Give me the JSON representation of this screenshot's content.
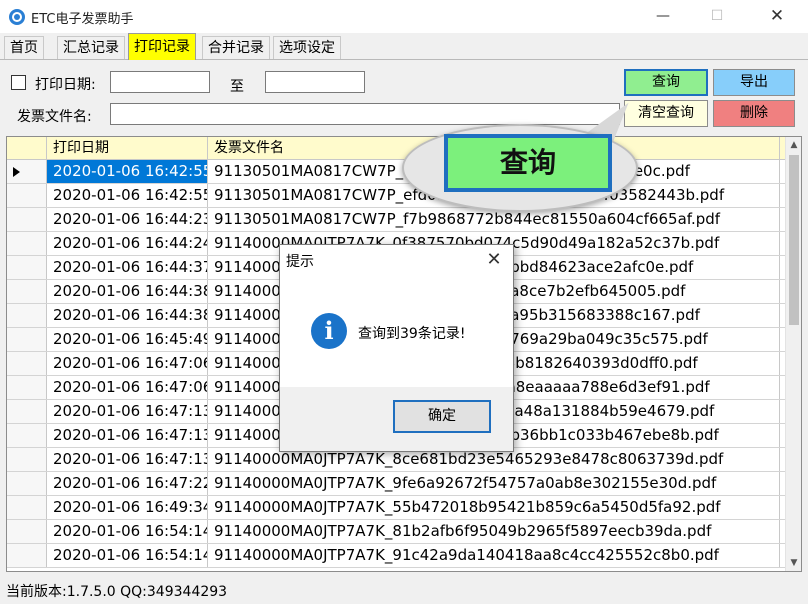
{
  "window": {
    "title": "ETC电子发票助手",
    "minimize": "—",
    "maximize": "☐",
    "close": "✕"
  },
  "tabs": [
    {
      "label": "首页"
    },
    {
      "label": "汇总记录"
    },
    {
      "label": "打印记录",
      "active": true
    },
    {
      "label": "合并记录"
    },
    {
      "label": "选项设定"
    }
  ],
  "filters": {
    "print_date_label": "打印日期:",
    "to_label": "至",
    "start_date": "",
    "end_date": "",
    "filename_label": "发票文件名:",
    "filename_value": ""
  },
  "buttons": {
    "query": "查询",
    "export": "导出",
    "clear_query": "清空查询",
    "delete": "删除"
  },
  "colors": {
    "query": "#90ee90",
    "export": "#87cefa",
    "clear_query": "#ffffe0",
    "delete": "#f08080",
    "header": "#fffbcc",
    "selection": "#0078d7"
  },
  "grid": {
    "columns": [
      "打印日期",
      "发票文件名"
    ],
    "rows": [
      {
        "date": "2020-01-06 16:42:55",
        "file": "91130501MA0817CW7P_e0ce2e22ee4b0f8e3d1d8b47ae0c.pdf"
      },
      {
        "date": "2020-01-06 16:42:55",
        "file": "91130501MA0817CW7P_efd01e4906074fbf9587b7403582443b.pdf"
      },
      {
        "date": "2020-01-06 16:44:23",
        "file": "91130501MA0817CW7P_f7b9868772b844ec81550a604cf665af.pdf"
      },
      {
        "date": "2020-01-06 16:44:24",
        "file": "91140000MA0JTP7A7K_0f387570bd074c5d90d49a182a52c37b.pdf"
      },
      {
        "date": "2020-01-06 16:44:37",
        "file": "91140000MA0JTP7A7K_1b3e2c0e5f6d4bbd84623ace2afc0e.pdf"
      },
      {
        "date": "2020-01-06 16:44:38",
        "file": "91140000MA0JTP7A7K_2c4e1f0a9b5d1a8ce7b2efb645005.pdf"
      },
      {
        "date": "2020-01-06 16:44:38",
        "file": "91140000MA0JTP7A7K_3d6b8a7e2c1f4a95b315683388c167.pdf"
      },
      {
        "date": "2020-01-06 16:45:49",
        "file": "91140000MA0JTP7A7K_4e7c9b8f3d2e4769a29ba049c35c575.pdf"
      },
      {
        "date": "2020-01-06 16:47:06",
        "file": "91140000MA0JTP7A7K_5f8dac9e4e3f48b8182640393d0dff0.pdf"
      },
      {
        "date": "2020-01-06 16:47:06",
        "file": "91140000MA0JTP7A7K_6a9ebdaf5f4e4a8eaaaaa788e6d3ef91.pdf"
      },
      {
        "date": "2020-01-06 16:47:13",
        "file": "91140000MA0JTP7A7K_7bafce0a6a5f4aa48a131884b59e4679.pdf"
      },
      {
        "date": "2020-01-06 16:47:13",
        "file": "91140000MA0JTP7A7K_8cb0df1b7b6a4b36bb1c033b467ebe8b.pdf"
      },
      {
        "date": "2020-01-06 16:47:13",
        "file": "91140000MA0JTP7A7K_8ce681bd23e5465293e8478c8063739d.pdf"
      },
      {
        "date": "2020-01-06 16:47:22",
        "file": "91140000MA0JTP7A7K_9fe6a92672f54757a0ab8e302155e30d.pdf"
      },
      {
        "date": "2020-01-06 16:49:34",
        "file": "91140000MA0JTP7A7K_55b472018b95421b859c6a5450d5fa92.pdf"
      },
      {
        "date": "2020-01-06 16:54:14",
        "file": "91140000MA0JTP7A7K_81b2afb6f95049b2965f5897eecb39da.pdf"
      },
      {
        "date": "2020-01-06 16:54:14",
        "file": "91140000MA0JTP7A7K_91c42a9da140418aa8c4cc425552c8b0.pdf"
      }
    ]
  },
  "callout": {
    "label": "查询"
  },
  "dialog": {
    "title": "提示",
    "close": "✕",
    "icon": "info-icon",
    "icon_glyph": "i",
    "message": "查询到39条记录!",
    "ok": "确定"
  },
  "status": {
    "text": "当前版本:1.7.5.0  QQ:349344293"
  }
}
